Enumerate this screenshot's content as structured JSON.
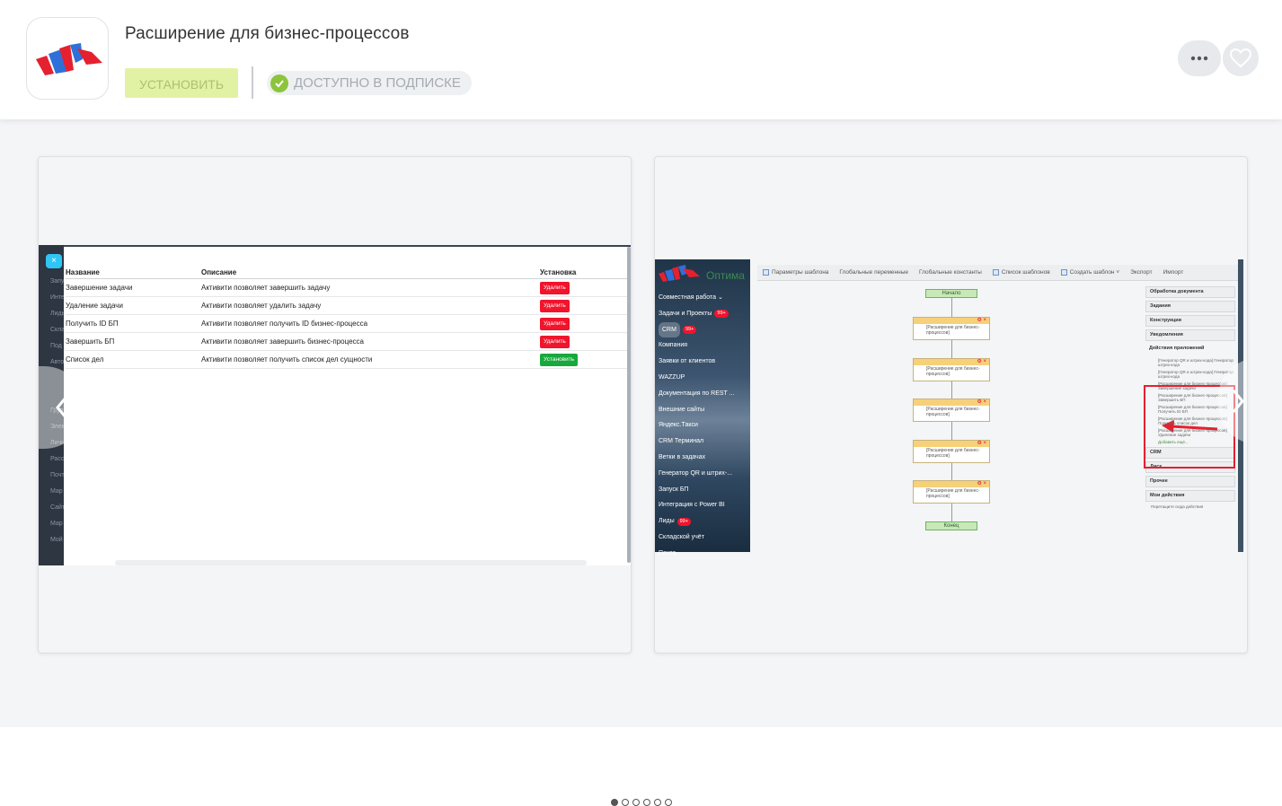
{
  "app": {
    "title": "Расширение для бизнес-процессов",
    "install_label": "УСТАНОВИТЬ",
    "subscription_label": "ДОСТУПНО В ПОДПИСКЕ",
    "more_icon": "more-icon",
    "favorite_icon": "heart-icon",
    "colors": {
      "install_bg": "#e2f2a4",
      "check": "#8cc43c",
      "logo_red": "#e5202f",
      "logo_blue": "#2f6fd8"
    }
  },
  "gallery": {
    "slide_count": 6,
    "active_slide": 1,
    "screenshot1": {
      "sidebar_items": [
        "Запу",
        "Инте",
        "Лиды",
        "Скла",
        "Под",
        "Авто",
        "",
        "",
        "Груп",
        "Элем",
        "Личн",
        "Расс",
        "Почт",
        "Мар",
        "Сайт",
        "Мар",
        "Мой"
      ],
      "close_label": "×",
      "headers": [
        "Название",
        "Описание",
        "Установка"
      ],
      "rows": [
        {
          "name": "Завершение задачи",
          "desc": "Активити позволяет завершить задачу",
          "action": "Удалить"
        },
        {
          "name": "Удаление задачи",
          "desc": "Активити позволяет удалить задачу",
          "action": "Удалить"
        },
        {
          "name": "Получить ID БП",
          "desc": "Активити позволяет получить ID бизнес-процесса",
          "action": "Удалить"
        },
        {
          "name": "Завершить БП",
          "desc": "Активити позволяет завершить бизнес-процесса",
          "action": "Удалить"
        },
        {
          "name": "Список дел",
          "desc": "Активити позволяет получить список дел сущности",
          "action": "Установить"
        }
      ]
    },
    "screenshot2": {
      "brand": "Оптима",
      "menu": [
        {
          "label": "Совместная работа ⌄"
        },
        {
          "label": "Задачи и Проекты",
          "badge": "99+"
        },
        {
          "label": "CRM",
          "badge": "99+"
        },
        {
          "label": "Компания"
        },
        {
          "label": "Заявки от клиентов"
        },
        {
          "label": "WAZZUP"
        },
        {
          "label": "Документация по REST ..."
        },
        {
          "label": "Внешние сайты"
        },
        {
          "label": "Яндекс.Такси"
        },
        {
          "label": "CRM Терминал"
        },
        {
          "label": "Ветки в задачах"
        },
        {
          "label": "Генератор QR и штрих-..."
        },
        {
          "label": "Запуск БП"
        },
        {
          "label": "Интеграция с Power BI"
        },
        {
          "label": "Лиды",
          "badge": "99+"
        },
        {
          "label": "Складской учёт"
        },
        {
          "label": "Почта"
        }
      ],
      "toolbar": [
        "Параметры шаблона",
        "Глобальные переменные",
        "Глобальные константы",
        "Список шаблонов",
        "Создать шаблон ˅",
        "Экспорт",
        "Импорт"
      ],
      "flow_start": "Начало",
      "flow_end": "Конец",
      "flow_block": "[Расширение для бизнес-процессов]",
      "panel": [
        "Обработка документа",
        "Задания",
        "Конструкции",
        "Уведомления",
        "Действия приложений"
      ],
      "panel_items": [
        "[Генератор QR и штрих-кода] Генератор штрих-кода",
        "[Генератор QR и штрих-кода] Генератор штрих-кода",
        "[Расширение для бизнес-процессов] Завершение задачи",
        "[Расширение для бизнес-процессов] Завершить БП",
        "[Расширение для бизнес-процессов] Получить ID БП",
        "[Расширение для бизнес-процессов] Получить список дел",
        "[Расширение для бизнес-процессов] Удаление задачи"
      ],
      "add_more": "Добавить ещё...",
      "panel_bottom": [
        "CRM",
        "Диск",
        "Прочее",
        "Мои действия"
      ],
      "drag_hint": "Перетащите сюда действия"
    }
  }
}
